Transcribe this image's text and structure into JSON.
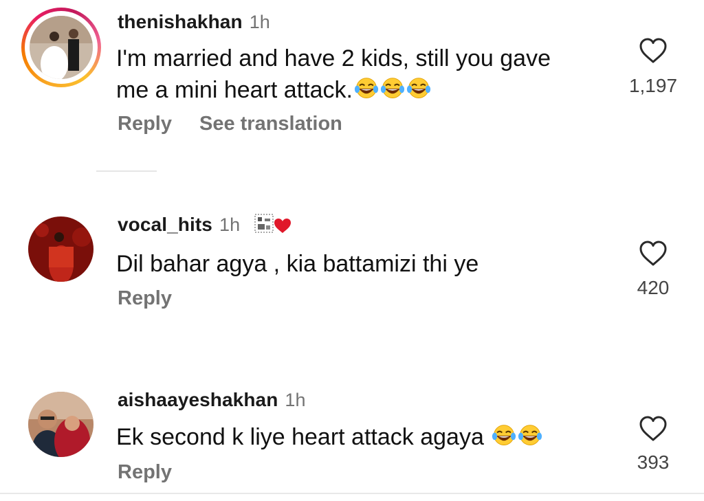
{
  "comments": [
    {
      "username": "thenishakhan",
      "time": "1h",
      "text": "I'm married and have 2 kids, still you gave",
      "text2": "me a mini heart attack.",
      "reply": "Reply",
      "translate": "See translation",
      "likes": "1,197",
      "emoji_count": 3
    },
    {
      "username": "vocal_hits",
      "time": "1h",
      "text": "Dil bahar agya , kia battamizi thi ye",
      "reply": "Reply",
      "likes": "420"
    },
    {
      "username": "aishaayeshakhan",
      "time": "1h",
      "text": "Ek second k liye heart attack agaya",
      "reply": "Reply",
      "likes": "393",
      "emoji_count": 2
    }
  ],
  "icons": {
    "like": "heart-outline-icon",
    "emoji": "face-with-tears-of-joy-emoji"
  },
  "colors": {
    "username": "#1a1a1a",
    "muted": "#737373",
    "story_ring": "#e91e63"
  }
}
